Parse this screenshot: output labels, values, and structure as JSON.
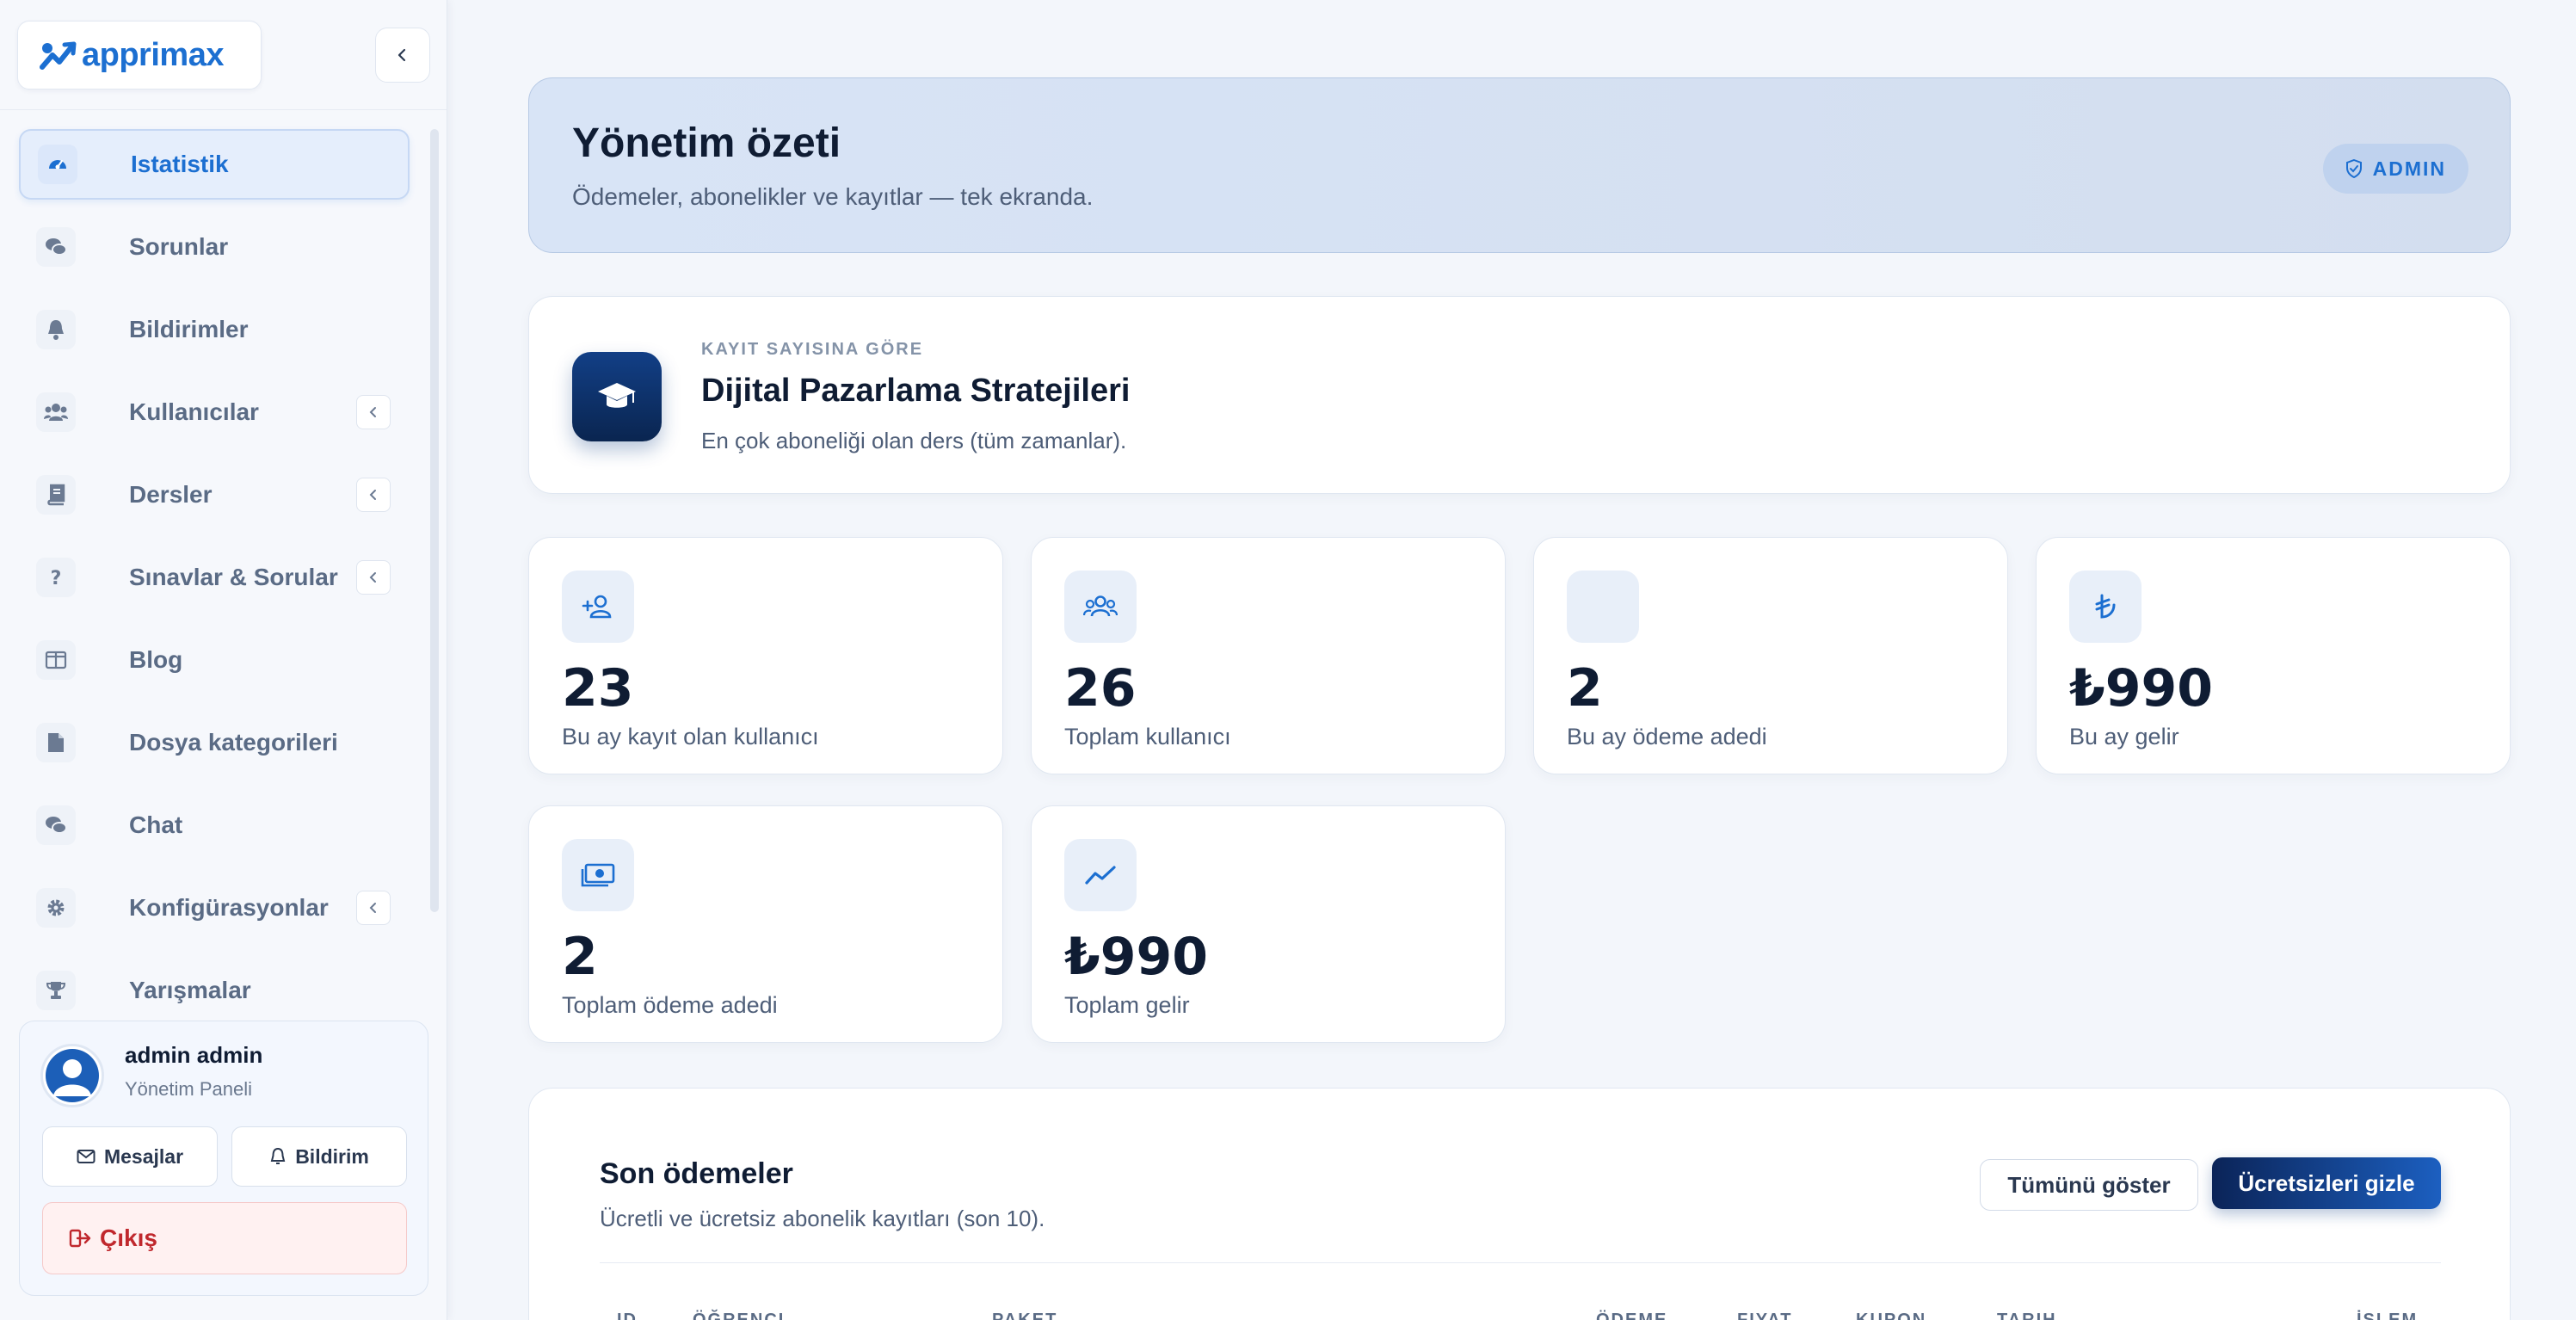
{
  "brand": {
    "name": "apprimax",
    "color": "#1c6fd1"
  },
  "sidebar": {
    "items": [
      {
        "label": "Istatistik",
        "icon": "gauge-icon",
        "active": true,
        "has_submenu": false
      },
      {
        "label": "Sorunlar",
        "icon": "chat-bubbles-icon",
        "active": false,
        "has_submenu": false
      },
      {
        "label": "Bildirimler",
        "icon": "bell-icon",
        "active": false,
        "has_submenu": false
      },
      {
        "label": "Kullanıcılar",
        "icon": "users-icon",
        "active": false,
        "has_submenu": true
      },
      {
        "label": "Dersler",
        "icon": "book-icon",
        "active": false,
        "has_submenu": true
      },
      {
        "label": "Sınavlar & Sorular",
        "icon": "question-icon",
        "active": false,
        "has_submenu": true
      },
      {
        "label": "Blog",
        "icon": "columns-icon",
        "active": false,
        "has_submenu": false
      },
      {
        "label": "Dosya kategorileri",
        "icon": "file-icon",
        "active": false,
        "has_submenu": false
      },
      {
        "label": "Chat",
        "icon": "chat-bubbles-icon",
        "active": false,
        "has_submenu": false
      },
      {
        "label": "Konfigürasyonlar",
        "icon": "gear-icon",
        "active": false,
        "has_submenu": true
      },
      {
        "label": "Yarışmalar",
        "icon": "trophy-icon",
        "active": false,
        "has_submenu": false
      }
    ],
    "user": {
      "name": "admin admin",
      "role": "Yönetim Paneli",
      "messages_label": "Mesajlar",
      "notifications_label": "Bildirim",
      "logout_label": "Çıkış"
    }
  },
  "hero": {
    "title": "Yönetim özeti",
    "subtitle": "Ödemeler, abonelikler ve kayıtlar — tek ekranda.",
    "badge": "ADMIN"
  },
  "top_course": {
    "kicker": "KAYIT SAYISINA GÖRE",
    "title": "Dijital Pazarlama Stratejileri",
    "subtitle": "En çok aboneliği olan ders (tüm zamanlar)."
  },
  "stats": [
    {
      "value": "23",
      "label": "Bu ay kayıt olan kullanıcı",
      "icon": "user-plus-icon"
    },
    {
      "value": "26",
      "label": "Toplam kullanıcı",
      "icon": "users-icon"
    },
    {
      "value": "2",
      "label": "Bu ay ödeme adedi",
      "icon": "blank-icon"
    },
    {
      "value": "₺990",
      "label": "Bu ay gelir",
      "icon": "lira-icon"
    },
    {
      "value": "2",
      "label": "Toplam ödeme adedi",
      "icon": "money-bill-icon"
    },
    {
      "value": "₺990",
      "label": "Toplam gelir",
      "icon": "trend-line-icon"
    }
  ],
  "payments": {
    "title": "Son ödemeler",
    "subtitle": "Ücretli ve ücretsiz abonelik kayıtları (son 10).",
    "show_all_label": "Tümünü göster",
    "hide_free_label": "Ücretsizleri gizle",
    "columns": [
      "ID",
      "ÖĞRENCI",
      "PAKET",
      "ÖDEME",
      "FIYAT",
      "KUPON",
      "TARIH",
      "İŞLEM"
    ]
  },
  "colors": {
    "accent": "#1c6fd1",
    "navy": "#0b2458",
    "danger": "#c0282d",
    "page_bg": "#f3f6fb"
  }
}
